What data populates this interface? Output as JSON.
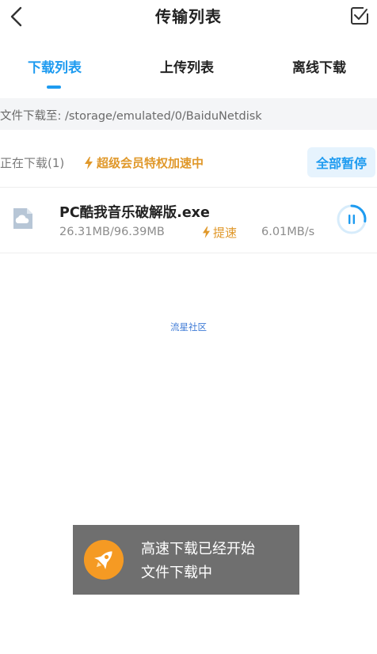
{
  "header": {
    "title": "传输列表",
    "back_icon": "chevron-left-icon",
    "edit_icon": "checkbox-edit-icon"
  },
  "tabs": [
    {
      "label": "下载列表",
      "active": true
    },
    {
      "label": "上传列表",
      "active": false
    },
    {
      "label": "离线下载",
      "active": false
    }
  ],
  "path": {
    "text": "文件下载至: /storage/emulated/0/BaiduNetdisk"
  },
  "status": {
    "downloading_label": "正在下载(1)",
    "vip_text": "超级会员特权加速中",
    "pause_all_label": "全部暂停"
  },
  "files": [
    {
      "name": "PC酷我音乐破解版.exe",
      "size": "26.31MB/96.39MB",
      "boost_label": "提速",
      "speed": "6.01MB/s",
      "progress_fraction": 0.273,
      "state_icon": "pause-icon"
    }
  ],
  "watermark": "流星社区",
  "toast": {
    "line1": "高速下载已经开始",
    "line2": "文件下载中",
    "icon": "rocket-icon"
  },
  "colors": {
    "accent": "#1e9bf0",
    "vip": "#e0982a",
    "toast_bg": "#646464",
    "toast_icon_bg": "#f59a23"
  }
}
